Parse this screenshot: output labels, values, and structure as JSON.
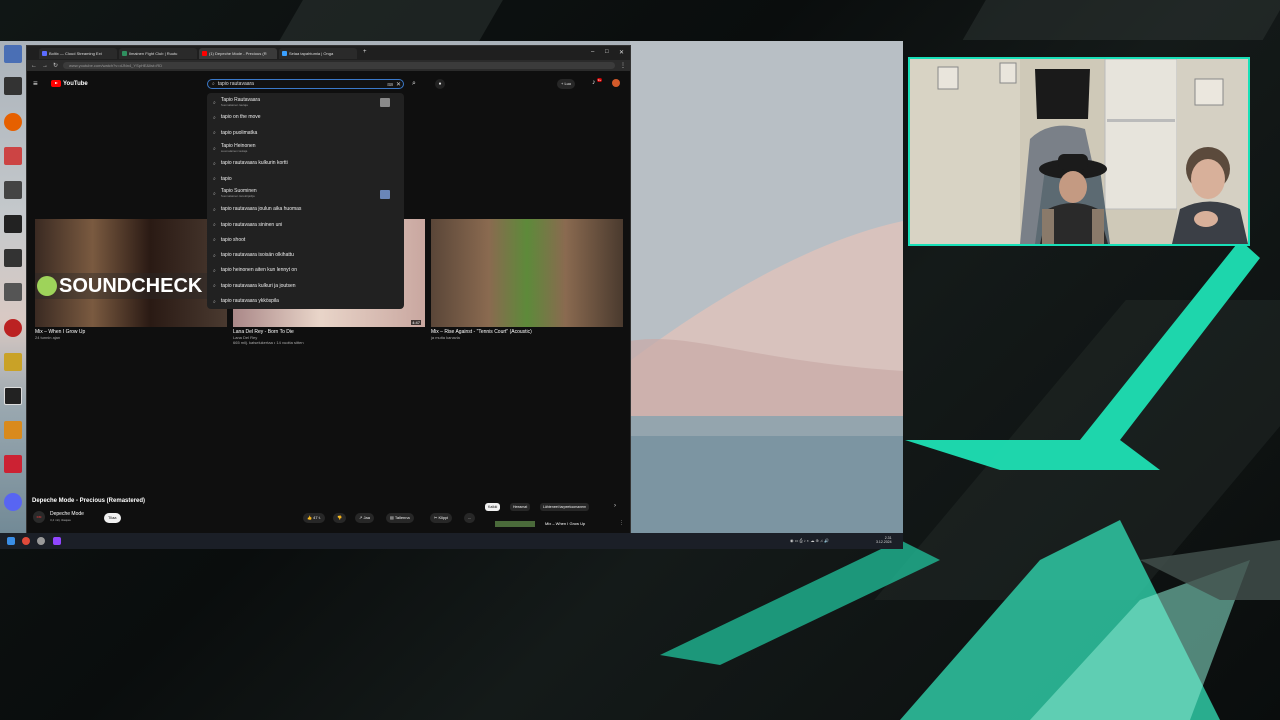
{
  "browser": {
    "tabs": [
      {
        "label": "Boltix — Cloud Streaming Ext",
        "color": "#5b6cff"
      },
      {
        "label": "Ilmainen Fight Club | Ruutu",
        "color": "#2f8f5f"
      },
      {
        "label": "(1) Depeche Mode - Precious (R",
        "color": "#ff0000"
      },
      {
        "label": "Selaa tapahtumia | Onga",
        "color": "#3aa0ff"
      }
    ],
    "url": "www.youtube.com/watch?v=dJNn4_YSpHE&list=RD"
  },
  "youtube": {
    "logo_text": "YouTube",
    "search_value": "tapio rautavaara",
    "create_label": "Luo",
    "bell_badge": "9+",
    "suggestions": [
      {
        "text": "Tapio Rautavaara",
        "sub": "Suomalainen laulaja",
        "thumb": true
      },
      {
        "text": "tapio on the move",
        "sub": "",
        "thumb": false
      },
      {
        "text": "tapio puolimatka",
        "sub": "",
        "thumb": false
      },
      {
        "text": "Tapio Heinonen",
        "sub": "suomalainen laulaja",
        "thumb": false
      },
      {
        "text": "tapio rautavaara kulkurin kortti",
        "sub": "",
        "thumb": false
      },
      {
        "text": "tapio",
        "sub": "",
        "thumb": false
      },
      {
        "text": "Tapio Suominen",
        "sub": "Suomalainen tietokirjailija",
        "thumb": true
      },
      {
        "text": "tapio rautavaara joulun aika huomas",
        "sub": "",
        "thumb": false
      },
      {
        "text": "tapio rautavaara sininen uni",
        "sub": "",
        "thumb": false
      },
      {
        "text": "tapio shoot",
        "sub": "",
        "thumb": false
      },
      {
        "text": "tapio rautavaara isoisän olkihattu",
        "sub": "",
        "thumb": false
      },
      {
        "text": "tapio heinonen aiten kun lennyt on",
        "sub": "",
        "thumb": false
      },
      {
        "text": "tapio rautavaara kulkuri ja joutsen",
        "sub": "",
        "thumb": false
      },
      {
        "text": "tapio rautavaara ykköspila",
        "sub": "",
        "thumb": false
      }
    ],
    "videos": [
      {
        "title": "Mix – When I Grow Up",
        "meta": "24 tunnin ajan",
        "overlay": "SOUNDCHECK",
        "duration": ""
      },
      {
        "title": "Lana Del Rey - Born To Die",
        "meta": "Lana Del Rey",
        "meta2": "665 milj. katselukertaa • 14 vuotta sitten",
        "overlay": "",
        "duration": "4:47"
      },
      {
        "title": "Mix – Rise Against - \"Tennis Court\" (Acoustic)",
        "meta": "ja muita kanavia",
        "overlay": "",
        "duration": ""
      }
    ],
    "now_playing": {
      "title": "Depeche Mode - Precious (Remastered)",
      "channel": "Depeche Mode",
      "subs": "3,4 milj. tilaajaa",
      "subscribe": "Tilaa",
      "likes": "47 t.",
      "share": "Jaa",
      "save": "Tallenna",
      "clip": "Klippi",
      "more": "...",
      "chips": [
        "Kaikki",
        "Heeamat",
        "Lähteneet tarpeetoomanem"
      ],
      "up_next": "Mix – When I Grow Up"
    }
  },
  "taskbar": {
    "time": "2.31",
    "date": "3.12.2024"
  },
  "colors": {
    "accent": "#18e0b8",
    "yt_red": "#ff0000"
  }
}
